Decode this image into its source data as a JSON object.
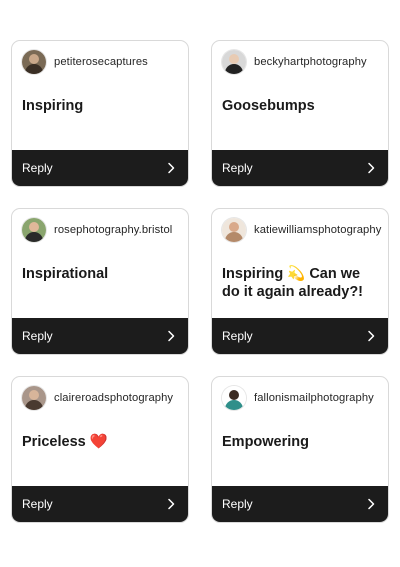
{
  "reply_label": "Reply",
  "comments": [
    {
      "username": "petiterosecaptures",
      "message": "Inspiring",
      "emoji": ""
    },
    {
      "username": "beckyhartphotography",
      "message": "Goosebumps",
      "emoji": ""
    },
    {
      "username": "rosephotography.bristol",
      "message": "Inspirational",
      "emoji": ""
    },
    {
      "username": "katiewilliamsphotography",
      "message": "Inspiring 💫 Can we do it again already?!",
      "emoji": ""
    },
    {
      "username": "claireroadsphotography",
      "message": "Priceless",
      "emoji": "❤️"
    },
    {
      "username": "fallonismailphotography",
      "message": "Empowering",
      "emoji": ""
    }
  ],
  "colors": {
    "reply_bar": "#1c1c1c",
    "card_border": "#d9d9d9"
  },
  "icons": {
    "reply_arrow": "chevron-right-icon",
    "profile": "avatar"
  }
}
